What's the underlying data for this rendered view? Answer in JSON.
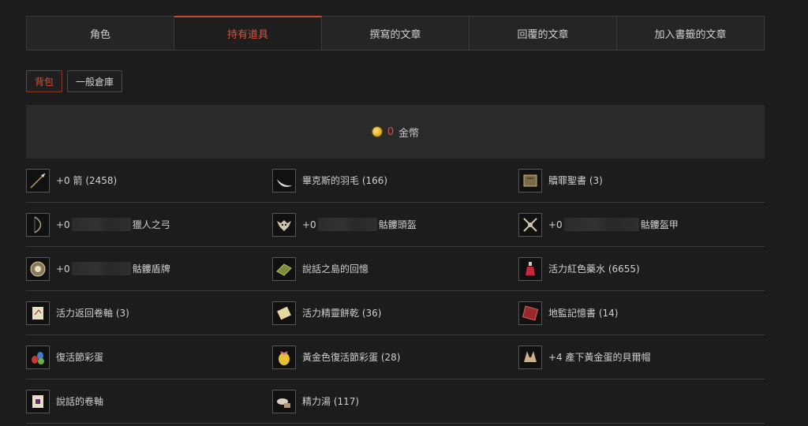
{
  "tabs": [
    {
      "label": "角色",
      "active": false
    },
    {
      "label": "持有道具",
      "active": true
    },
    {
      "label": "撰寫的文章",
      "active": false
    },
    {
      "label": "回覆的文章",
      "active": false
    },
    {
      "label": "加入書籤的文章",
      "active": false
    }
  ],
  "subtabs": [
    {
      "label": "背包",
      "active": true
    },
    {
      "label": "一般倉庫",
      "active": false
    }
  ],
  "gold": {
    "amount": "0",
    "label": "金幣"
  },
  "items": [
    {
      "pre": "+0 箭 (2458)",
      "post": ""
    },
    {
      "pre": "畢克斯的羽毛 (166)",
      "post": ""
    },
    {
      "pre": "贖罪聖書 (3)",
      "post": ""
    },
    {
      "pre": "+0",
      "post": "獵人之弓"
    },
    {
      "pre": "+0",
      "post": "骷髏頭盔"
    },
    {
      "pre": "+0",
      "post": "骷髏盔甲"
    },
    {
      "pre": "+0",
      "post": "骷髏盾牌"
    },
    {
      "pre": "說話之島的回憶",
      "post": ""
    },
    {
      "pre": "活力紅色藥水 (6655)",
      "post": ""
    },
    {
      "pre": "活力返回卷軸 (3)",
      "post": ""
    },
    {
      "pre": "活力精靈餅乾 (36)",
      "post": ""
    },
    {
      "pre": "地監記憶書 (14)",
      "post": ""
    },
    {
      "pre": "復活節彩蛋",
      "post": ""
    },
    {
      "pre": "黃金色復活節彩蛋 (28)",
      "post": ""
    },
    {
      "pre": "+4 產下黃金蛋的貝爾帽",
      "post": ""
    },
    {
      "pre": "說話的卷軸",
      "post": ""
    },
    {
      "pre": "精力湯 (117)",
      "post": ""
    }
  ],
  "icons": [
    "arrow-icon",
    "feather-icon",
    "holy-book-icon",
    "bow-icon",
    "skull-helmet-icon",
    "skull-armor-icon",
    "skull-shield-icon",
    "island-memory-icon",
    "red-potion-icon",
    "return-scroll-icon",
    "elven-cookie-icon",
    "dungeon-book-icon",
    "easter-eggs-icon",
    "golden-egg-icon",
    "bell-hat-icon",
    "talking-scroll-icon",
    "energy-soup-icon"
  ],
  "colors": {
    "accent": "#d2553f",
    "background": "#1c1c1c",
    "panel": "#2a2a2a",
    "border": "#3a3a3a"
  }
}
